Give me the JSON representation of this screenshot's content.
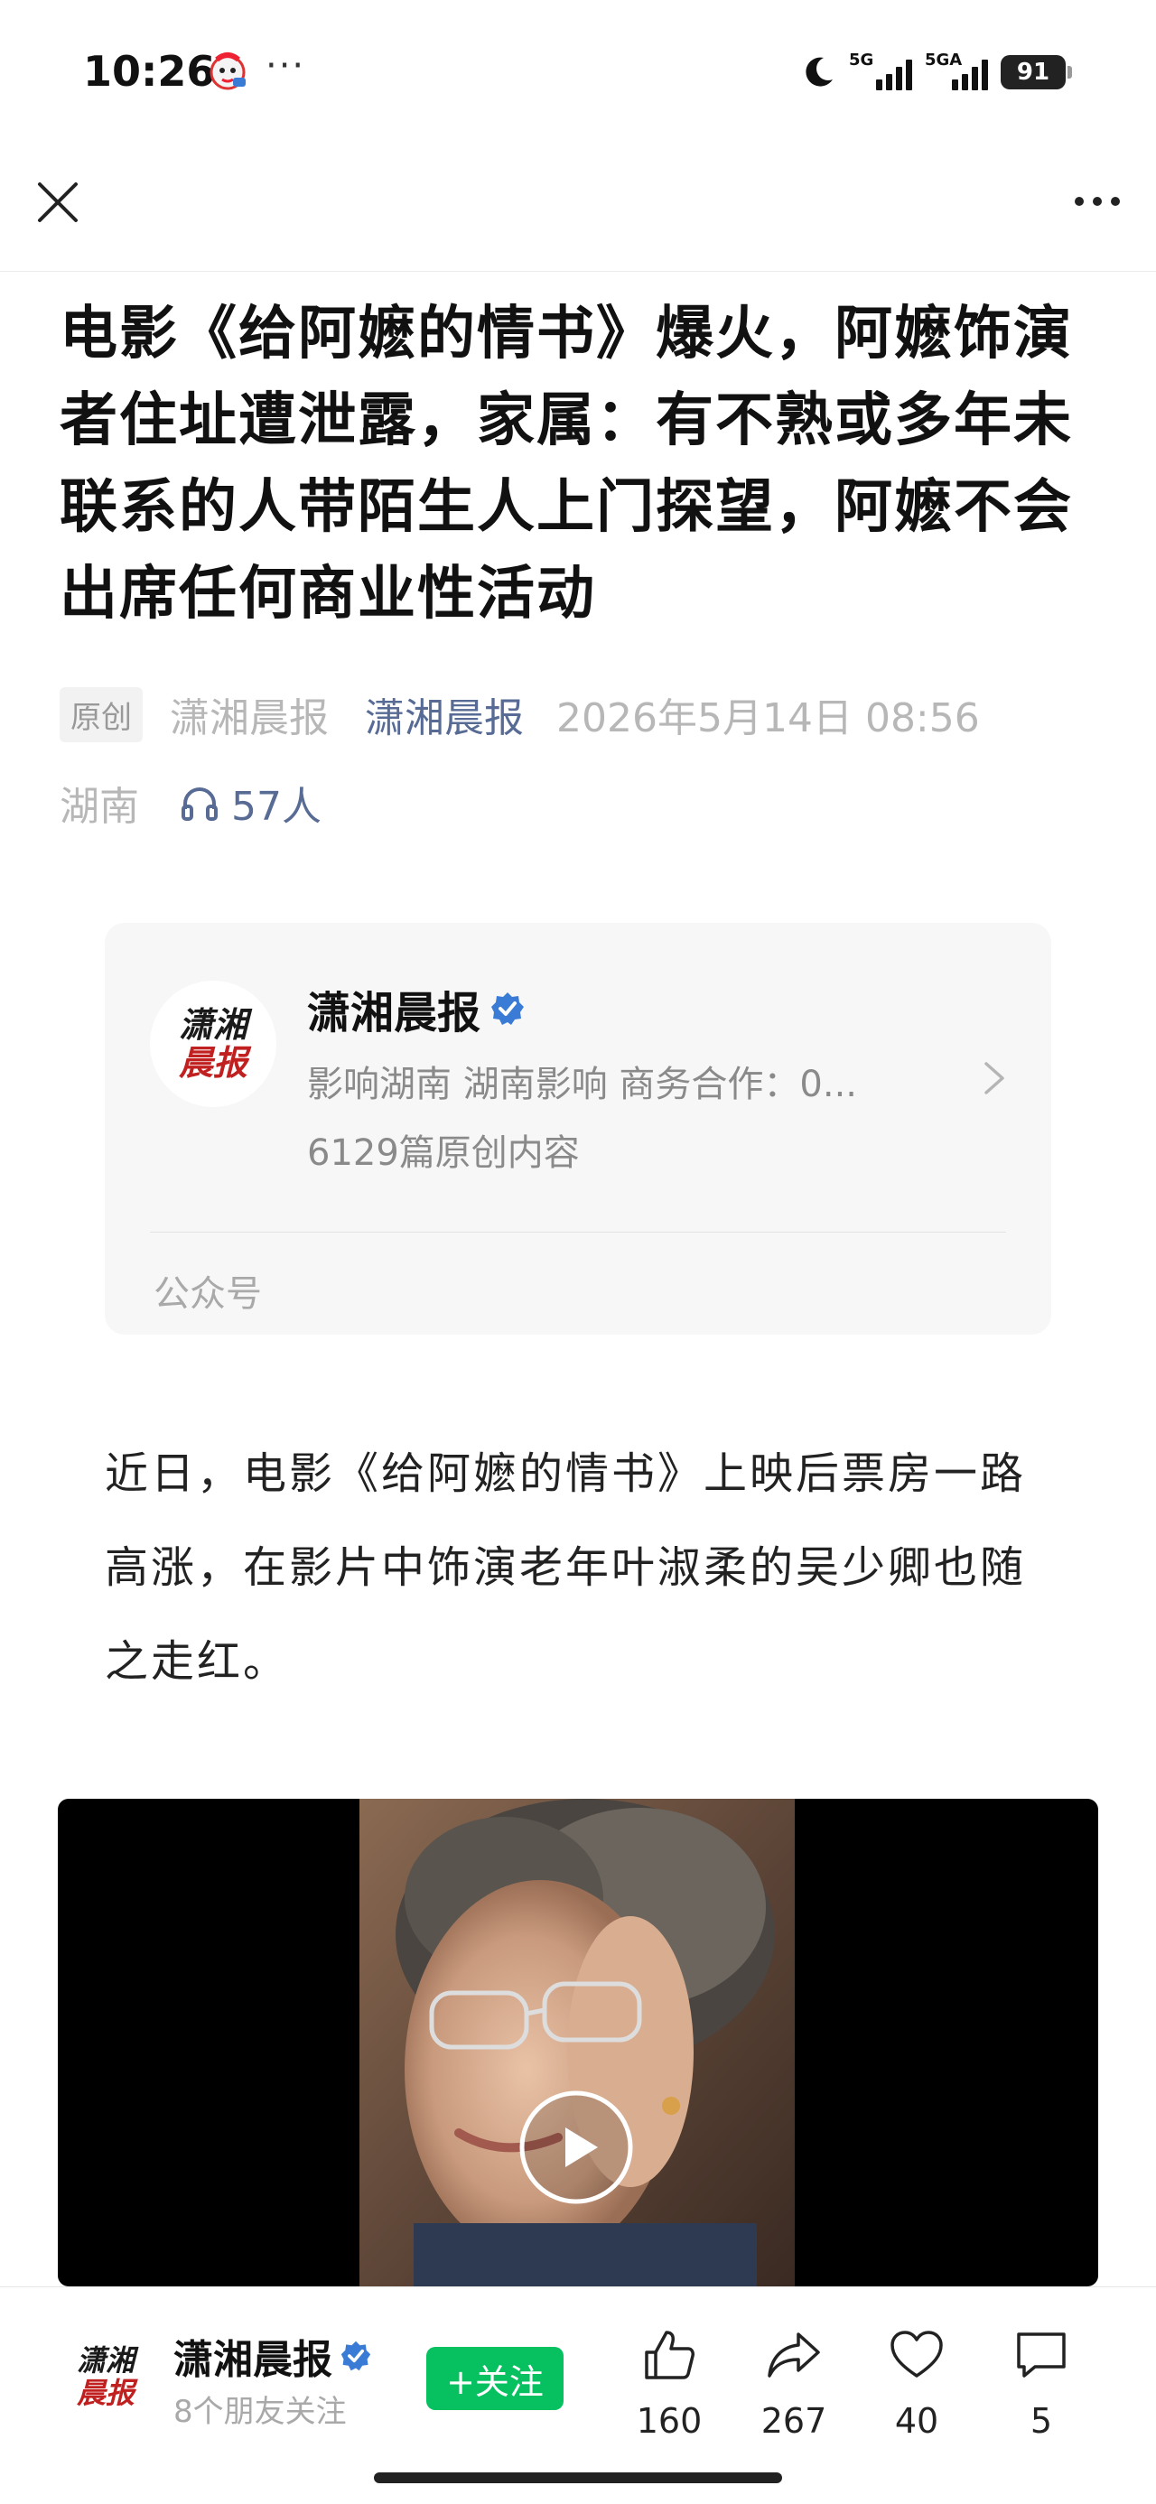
{
  "status_bar": {
    "time": "10:26",
    "more": "···",
    "signal1_label": "5G",
    "signal2_label": "5GA",
    "battery": "91"
  },
  "nav": {
    "close_icon": "close-icon",
    "more_icon": "more-icon"
  },
  "article": {
    "title": "电影《给阿嬷的情书》爆火，阿嬷饰演者住址遭泄露，家属：有不熟或多年未联系的人带陌生人上门探望，阿嬷不会出席任何商业性活动",
    "original_tag": "原创",
    "author": "潇湘晨报",
    "account_link": "潇湘晨报",
    "date": "2026年5月14日 08:56",
    "region": "湖南",
    "listeners": "57人"
  },
  "account_card": {
    "logo_line1": "潇湘",
    "logo_line2": "晨报",
    "name": "潇湘晨报",
    "description": "影响湖南 湖南影响 商务合作：0...",
    "original_count": "6129篇原创内容",
    "type": "公众号"
  },
  "body": {
    "paragraph1": "近日，电影《给阿嬷的情书》上映后票房一路高涨，在影片中饰演老年叶淑柔的吴少卿也随之走红。"
  },
  "bottom_bar": {
    "logo_line1": "潇湘",
    "logo_line2": "晨报",
    "name": "潇湘晨报",
    "friends_follow": "8个朋友关注",
    "follow_label": "+关注",
    "like_count": "160",
    "share_count": "267",
    "heart_count": "40",
    "comment_count": "5"
  },
  "colors": {
    "link": "#576b95",
    "follow_green": "#07c160",
    "verified_blue": "#3a7bd5",
    "logo_red": "#c0201f"
  }
}
